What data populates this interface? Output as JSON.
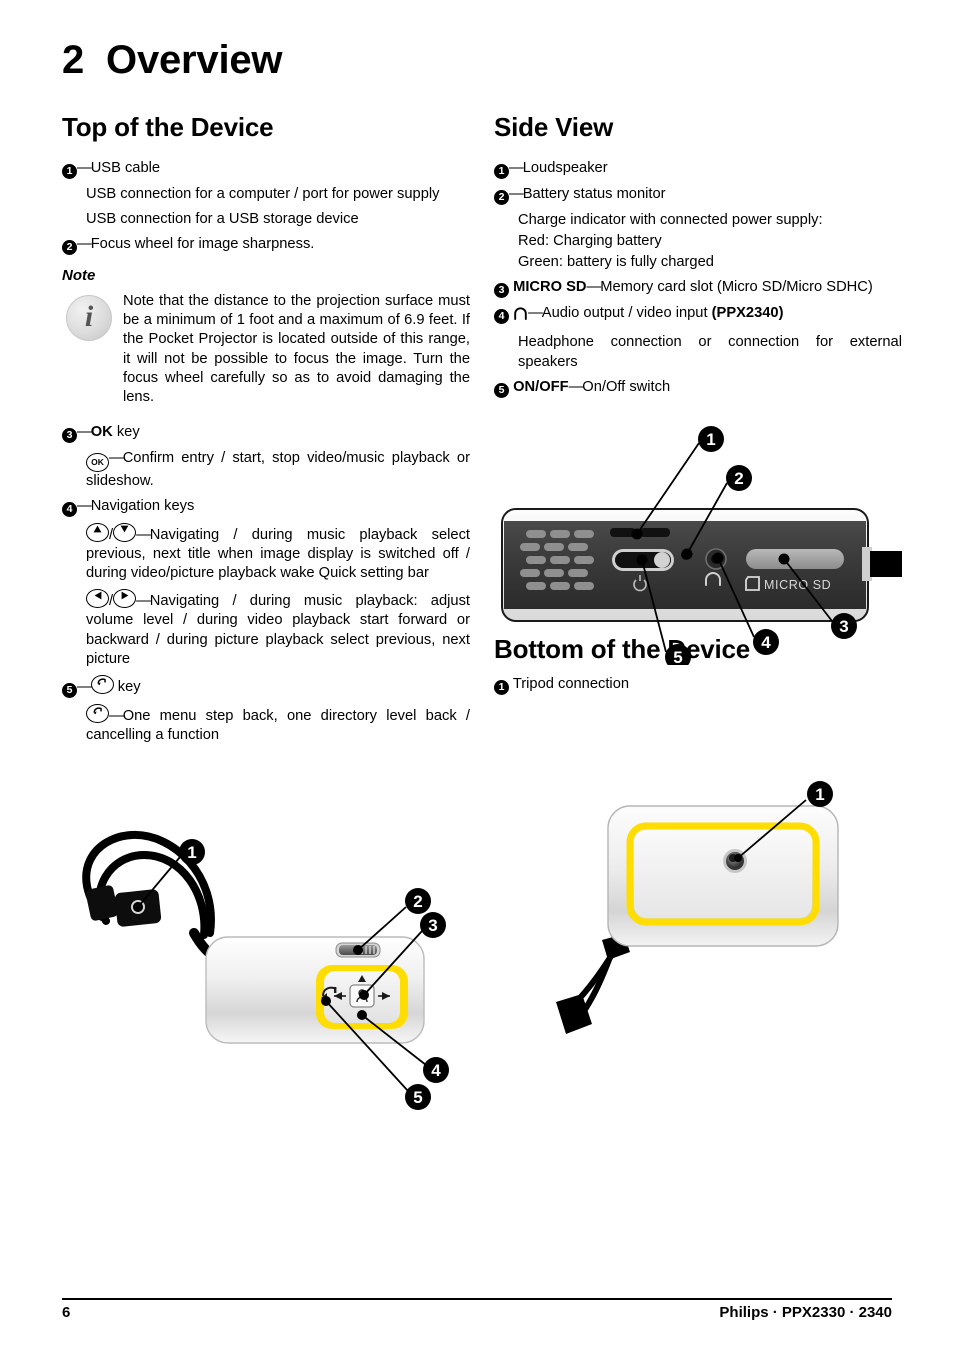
{
  "chapter": {
    "number": "2",
    "title": "Overview"
  },
  "left_column": {
    "heading": "Top of the Device",
    "item1_label": "USB cable",
    "item1_desc1": "USB connection for a computer / port for power supply",
    "item1_desc2": "USB connection for a USB storage device",
    "item2_label": "Focus wheel for image sharpness.",
    "note_title": "Note",
    "note_text": "Note that the distance to the projection surface must be a minimum of 1 foot and a maximum of 6.9 feet. If the Pocket Projector is located outside of this range, it will not be possible to focus the image. Turn the focus wheel carefully so as to avoid damaging the lens.",
    "item3_key": "OK",
    "item3_suffix": "key",
    "item3_desc": "Confirm entry / start, stop video/music playback or slideshow.",
    "item4_label": "Navigation keys",
    "item4_desc_updown": "Navigating / during music playback select previous, next title when image display is switched off / during video/picture playback wake Quick setting bar",
    "item4_desc_leftright": "Navigating / during music playback: adjust volume level / during video playback start forward or backward / during picture playback select previous, next picture",
    "item5_suffix": "key",
    "item5_desc": "One menu step back, one directory level back / cancelling a function"
  },
  "right_column": {
    "heading": "Side View",
    "item1_label": "Loudspeaker",
    "item2_label": "Battery status monitor",
    "item2_desc_line1": "Charge indicator with connected power supply:",
    "item2_desc_line2": "Red: Charging battery",
    "item2_desc_line3": "Green: battery is fully charged",
    "item3_key": "MICRO SD",
    "item3_desc": "Memory card slot (Micro SD/Micro SDHC)",
    "item4_desc": "Audio output / video input",
    "item4_model": "(PPX2340)",
    "item4_sub": "Headphone connection or connection for external speakers",
    "item5_key": "ON/OFF",
    "item5_desc": "On/Off switch"
  },
  "bottom_section": {
    "heading": "Bottom of the Device",
    "item1_label": "Tripod connection"
  },
  "figures": {
    "top_device": {
      "callouts": [
        "1",
        "2",
        "3",
        "4",
        "5"
      ],
      "keypad_color": "#FFDD00"
    },
    "side_device": {
      "callouts": [
        "1",
        "2",
        "3",
        "4",
        "5"
      ],
      "card_slot_label": "MICRO SD",
      "body_color": "#3a3a3a"
    },
    "bottom_device": {
      "callouts": [
        "1"
      ],
      "frame_color": "#FFDD00"
    }
  },
  "footer": {
    "page_number": "6",
    "imprint": "Philips · PPX2330 · 2340"
  },
  "colors": {
    "accent_yellow": "#FFDD00",
    "device_dark": "#3a3a3a",
    "text": "#000000"
  }
}
